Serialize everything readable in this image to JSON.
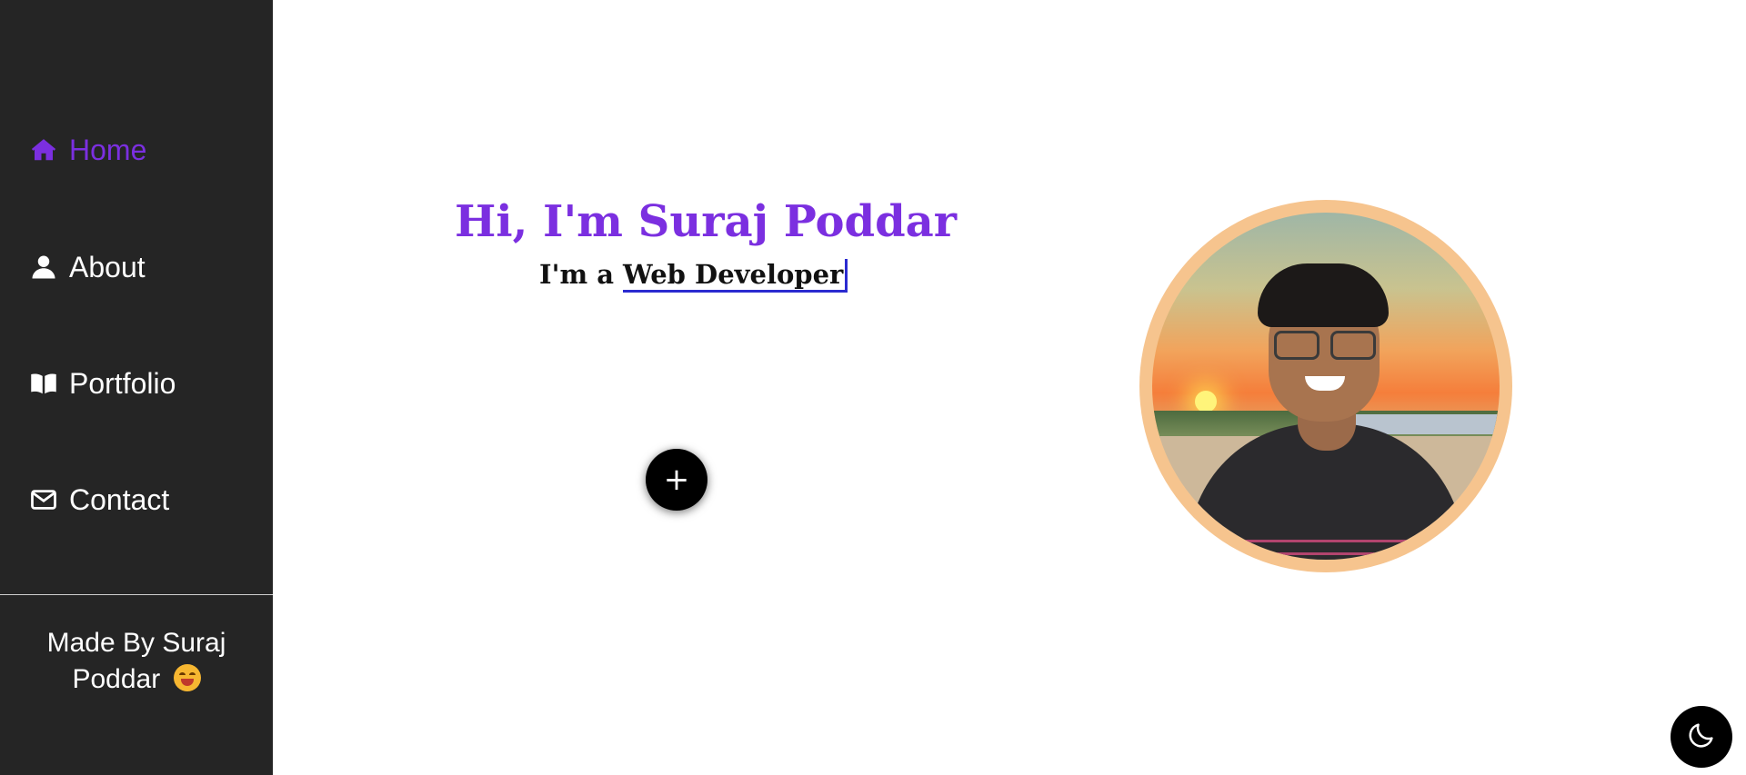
{
  "sidebar": {
    "items": [
      {
        "label": "Home",
        "icon": "home-icon",
        "active": true
      },
      {
        "label": "About",
        "icon": "user-icon",
        "active": false
      },
      {
        "label": "Portfolio",
        "icon": "book-icon",
        "active": false
      },
      {
        "label": "Contact",
        "icon": "mail-icon",
        "active": false
      }
    ],
    "footer": {
      "text": "Made By Suraj Poddar",
      "emoji": "grinning-squint-face"
    }
  },
  "hero": {
    "greeting": "Hi, I'm Suraj Poddar",
    "prefix": "I'm a",
    "role": "Web Developer",
    "add_button": "+"
  },
  "theme_toggle": {
    "icon": "moon-icon"
  },
  "colors": {
    "accent": "#7b2fe0",
    "sidebar_bg": "#252525",
    "avatar_ring": "#f6c48e",
    "typing_cursor": "#2b2bd0"
  }
}
